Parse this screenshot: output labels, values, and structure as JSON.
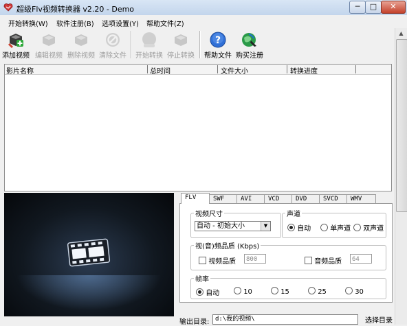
{
  "window": {
    "title": "超级Flv视频转换器 v2.20 - Demo",
    "controls": {
      "minimize": "─",
      "maximize": "□",
      "close": "✕"
    }
  },
  "menu": [
    "开始转换(W)",
    "软件注册(B)",
    "选项设置(Y)",
    "帮助文件(Z)"
  ],
  "toolbar": [
    {
      "label": "添加视频",
      "icon": "add-video-icon",
      "enabled": true
    },
    {
      "label": "编辑视频",
      "icon": "edit-video-icon",
      "enabled": false
    },
    {
      "label": "删除视频",
      "icon": "delete-video-icon",
      "enabled": false
    },
    {
      "label": "清除文件",
      "icon": "clear-files-icon",
      "enabled": false
    },
    {
      "label": "开始转换",
      "icon": "start-convert-icon",
      "enabled": false
    },
    {
      "label": "停止转换",
      "icon": "stop-convert-icon",
      "enabled": false
    },
    {
      "label": "帮助文件",
      "icon": "help-icon",
      "enabled": true
    },
    {
      "label": "购买注册",
      "icon": "buy-register-icon",
      "enabled": true
    }
  ],
  "list": {
    "columns": [
      "影片名称",
      "总时间",
      "文件大小",
      "转换进度"
    ],
    "rows": []
  },
  "tabs": [
    "FLV",
    "SWF",
    "AVI",
    "VCD",
    "DVD",
    "SVCD",
    "WMV"
  ],
  "active_tab": "FLV",
  "flv": {
    "video_size": {
      "legend": "视频尺寸",
      "value": "自动 - 初始大小"
    },
    "channel": {
      "legend": "声道",
      "options": [
        "自动",
        "单声道",
        "双声道"
      ],
      "selected": "自动"
    },
    "quality": {
      "legend": "视(音)频品质 (Kbps)",
      "video_label": "视频品质",
      "video_value": "800",
      "audio_label": "音频品质",
      "audio_value": "64"
    },
    "framerate": {
      "legend": "帧率",
      "options": [
        "自动",
        "10",
        "15",
        "25",
        "30"
      ],
      "selected": "自动"
    }
  },
  "output": {
    "label": "输出目录:",
    "path": "d:\\我的视频\\",
    "choose_button": "选择目录"
  },
  "colors": {
    "titlebar": "#c3d5ec",
    "close_button": "#c4412b",
    "disabled_text": "#9c9c9c"
  }
}
